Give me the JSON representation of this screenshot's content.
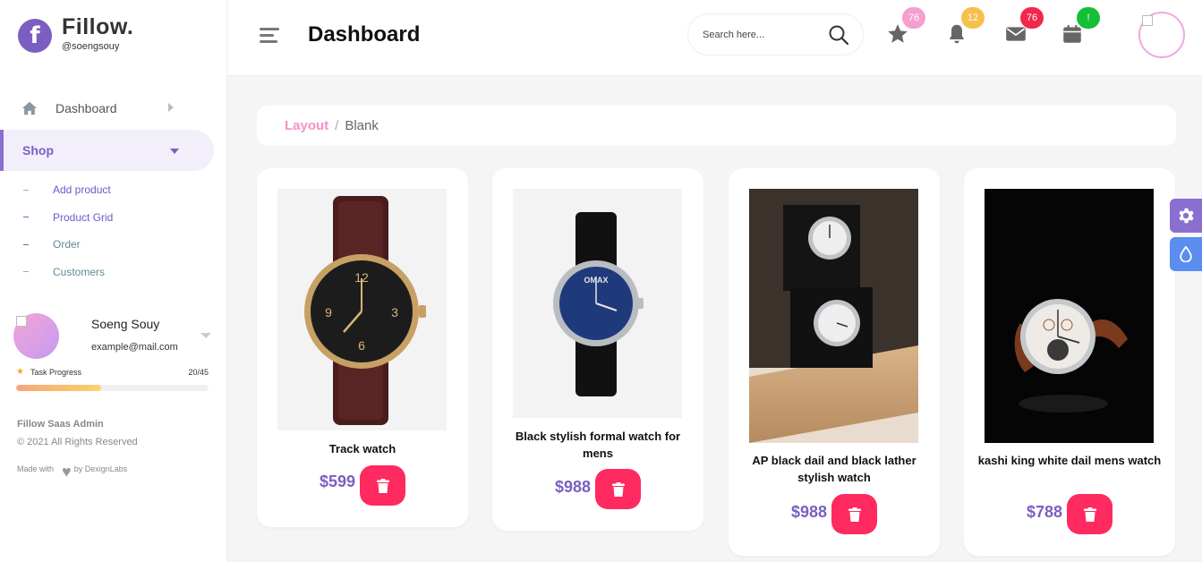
{
  "brand": {
    "logo_letter": "f",
    "name": "Fillow.",
    "username": "@soengsouy"
  },
  "sidebar": {
    "nav": [
      {
        "label": "Dashboard",
        "icon": "home-icon"
      },
      {
        "label": "Shop",
        "icon": ""
      }
    ],
    "submenu": [
      {
        "label": "Add product"
      },
      {
        "label": "Product Grid"
      },
      {
        "label": "Order"
      },
      {
        "label": "Customers"
      }
    ],
    "profile": {
      "name": "Soeng Souy",
      "email": "example@mail.com"
    },
    "task": {
      "label": "Task Progress",
      "count": "20/45",
      "progress": 0.444
    },
    "footer": {
      "title": "Fillow Saas Admin",
      "copyright": "© 2021 All Rights Reserved",
      "made_prefix": "Made with",
      "made_suffix": "by DexignLabs"
    }
  },
  "header": {
    "title": "Dashboard",
    "search_placeholder": "Search here...",
    "badges": {
      "star": "76",
      "bell": "12",
      "mail": "76",
      "calendar": "!"
    }
  },
  "breadcrumb": {
    "parent": "Layout",
    "separator": "/",
    "current": "Blank"
  },
  "products": [
    {
      "name": "Track watch",
      "price": "$599"
    },
    {
      "name": "Black stylish formal watch for mens",
      "price": "$988"
    },
    {
      "name": "AP black dail and black lather stylish watch",
      "price": "$988"
    },
    {
      "name": "kashi king white dail mens watch",
      "price": "$788"
    }
  ],
  "colors": {
    "accent": "#7b5fc0",
    "brand_pink": "#f58fc9",
    "delete_red": "#ff2a5f",
    "badge_pink": "#f59fcf",
    "badge_yellow": "#f6c14a",
    "badge_red": "#f0284b",
    "badge_green": "#13c037"
  }
}
